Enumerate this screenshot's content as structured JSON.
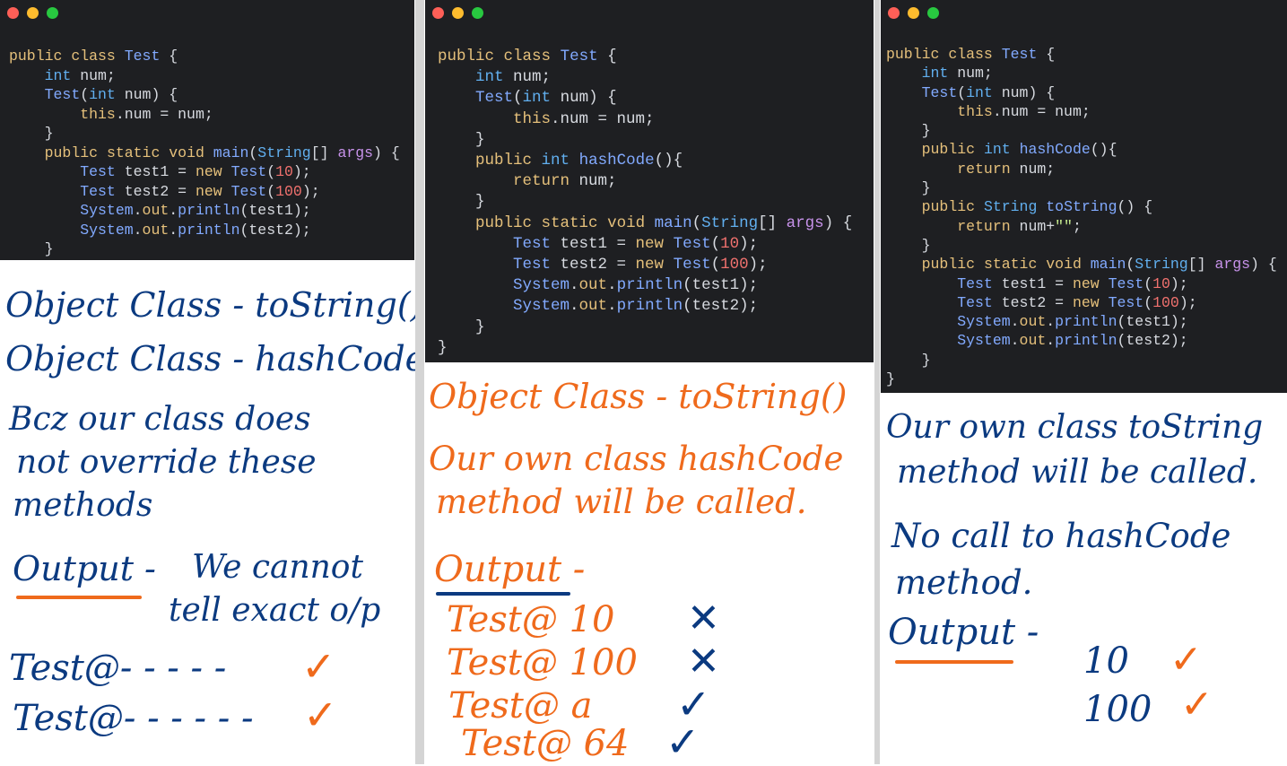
{
  "panels": [
    {
      "code": "public class Test {\n    int num;\n    Test(int num) {\n        this.num = num;\n    }\n    public static void main(String[] args) {\n        Test test1 = new Test(10);\n        Test test2 = new Test(100);\n        System.out.println(test1);\n        System.out.println(test2);\n    }",
      "notes": {
        "line1": "Object Class - toString()",
        "line2": "Object Class - hashCode()",
        "line3": "Bcz our class does",
        "line4": "not override these",
        "line5": "methods",
        "output_label": "Output -",
        "output_desc1": "We cannot",
        "output_desc2": "tell exact o/p",
        "out1": "Test@- - - - -",
        "out2": "Test@- - - - - -",
        "mark1": "✓",
        "mark2": "✓"
      }
    },
    {
      "code": "public class Test {\n    int num;\n    Test(int num) {\n        this.num = num;\n    }\n    public int hashCode(){\n        return num;\n    }\n    public static void main(String[] args) {\n        Test test1 = new Test(10);\n        Test test2 = new Test(100);\n        System.out.println(test1);\n        System.out.println(test2);\n    }\n}",
      "notes": {
        "line1": "Object Class - toString()",
        "line2": "Our own class hashCode",
        "line3": "method will be called.",
        "output_label": "Output -",
        "out1": "Test@ 10",
        "out2": "Test@ 100",
        "out3": "Test@ a",
        "out4": "Test@ 64",
        "mark1": "✕",
        "mark2": "✕",
        "mark3": "✓",
        "mark4": "✓"
      }
    },
    {
      "code": "public class Test {\n    int num;\n    Test(int num) {\n        this.num = num;\n    }\n    public int hashCode(){\n        return num;\n    }\n    public String toString() {\n        return num+\"\";\n    }\n    public static void main(String[] args) {\n        Test test1 = new Test(10);\n        Test test2 = new Test(100);\n        System.out.println(test1);\n        System.out.println(test2);\n    }\n}",
      "notes": {
        "line1": "Our own class toString",
        "line2": "method will be called.",
        "line3": "No call to hashCode",
        "line4": "method.",
        "output_label": "Output -",
        "out1": "10",
        "out2": "100",
        "mark1": "✓",
        "mark2": "✓"
      }
    }
  ],
  "colors": {
    "editor_bg": "#1e1f22",
    "ink_blue": "#0b3a80",
    "ink_orange": "#ef6a1c"
  }
}
